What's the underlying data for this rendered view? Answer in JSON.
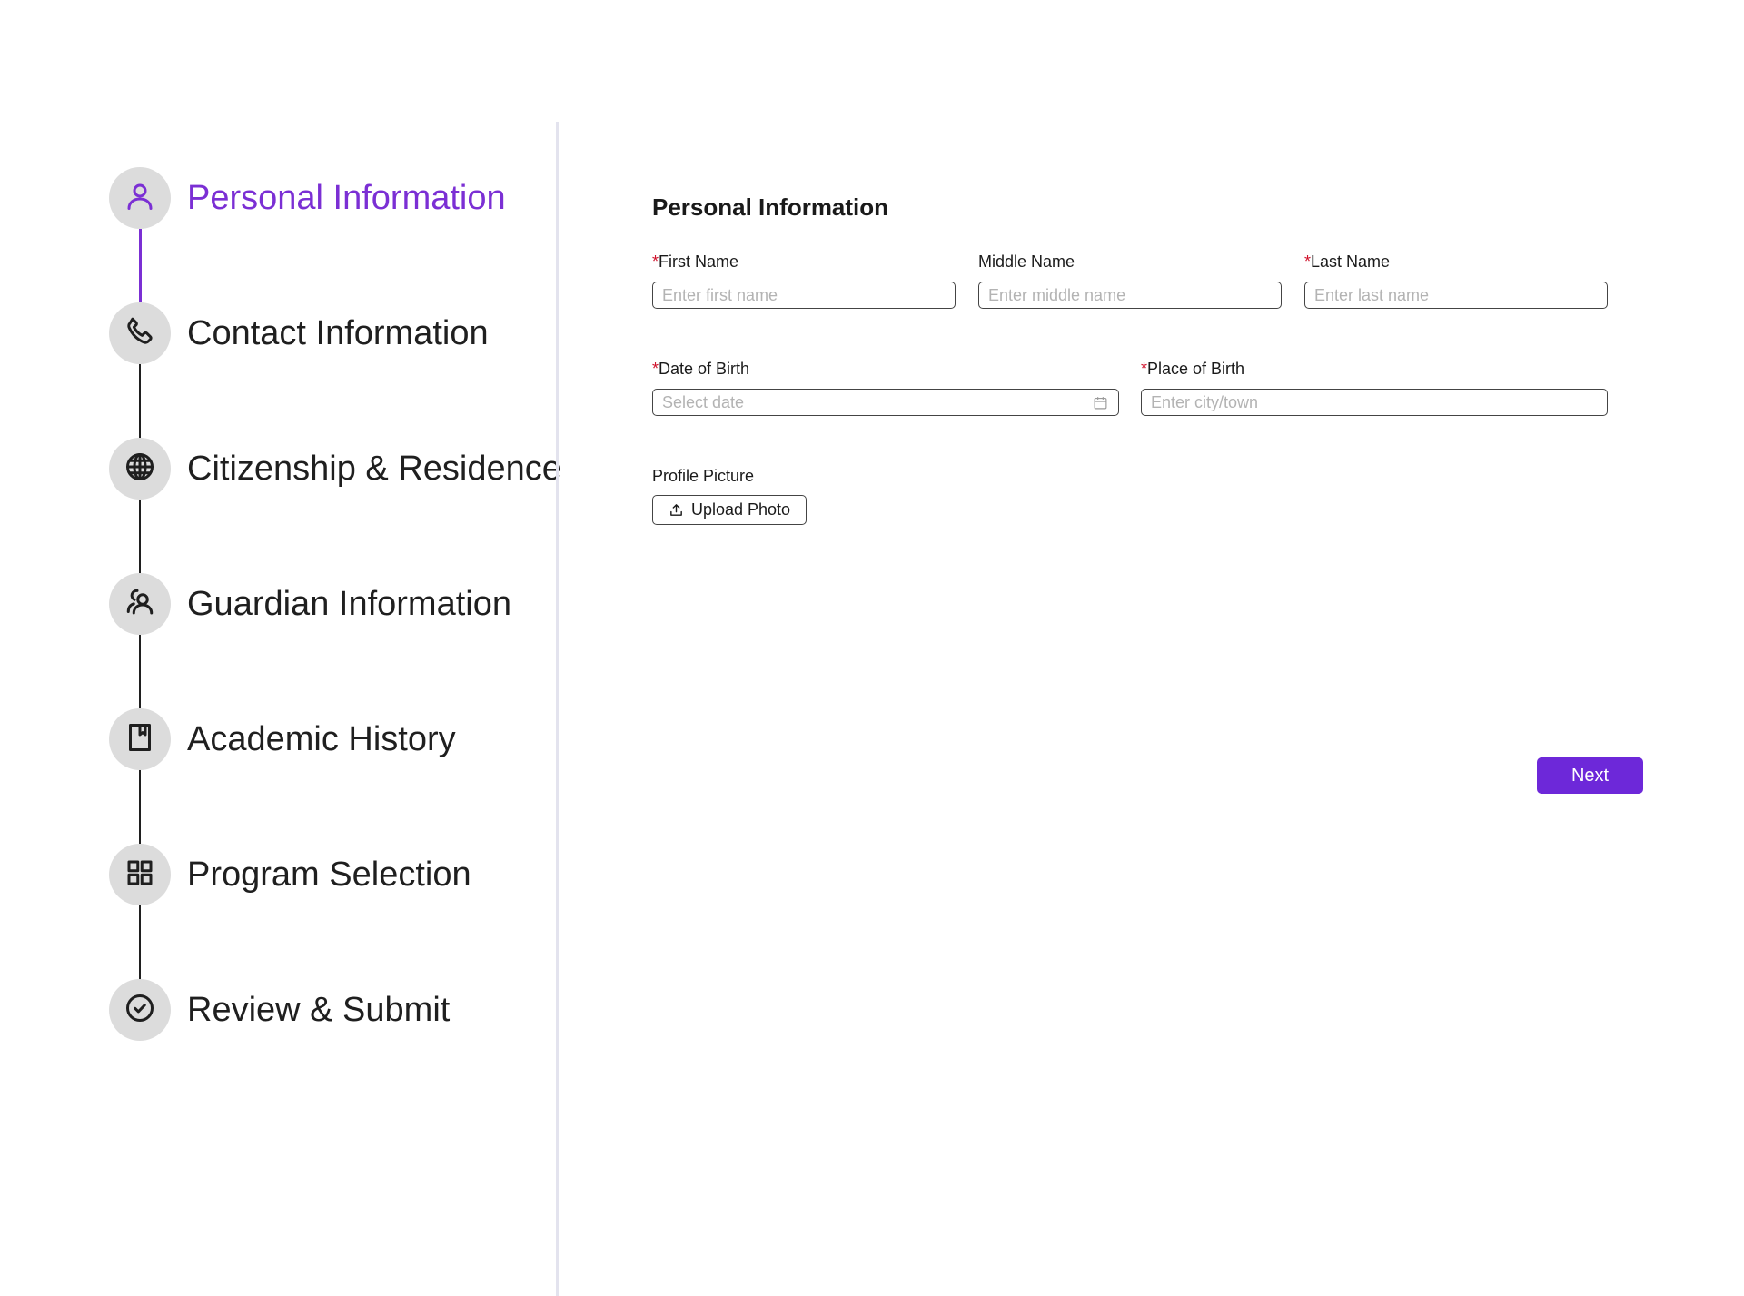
{
  "stepper": {
    "steps": [
      {
        "label": "Personal Information",
        "icon": "user-icon",
        "active": true
      },
      {
        "label": "Contact Information",
        "icon": "phone-icon",
        "active": false
      },
      {
        "label": "Citizenship & Residence",
        "icon": "globe-icon",
        "active": false
      },
      {
        "label": "Guardian Information",
        "icon": "users-icon",
        "active": false
      },
      {
        "label": "Academic History",
        "icon": "bookmark-book-icon",
        "active": false
      },
      {
        "label": "Program Selection",
        "icon": "grid-icon",
        "active": false
      },
      {
        "label": "Review & Submit",
        "icon": "check-circle-icon",
        "active": false
      }
    ],
    "active_color": "#7b2fd4",
    "circle_color": "#dcdcdc"
  },
  "form": {
    "title": "Personal Information",
    "required_marker": "*",
    "fields": {
      "first_name": {
        "label": "First Name",
        "placeholder": "Enter first name",
        "required": true
      },
      "middle_name": {
        "label": "Middle Name",
        "placeholder": "Enter middle name",
        "required": false
      },
      "last_name": {
        "label": "Last Name",
        "placeholder": "Enter last name",
        "required": true
      },
      "date_of_birth": {
        "label": "Date of Birth",
        "placeholder": "Select date",
        "required": true,
        "icon": "calendar-icon"
      },
      "place_of_birth": {
        "label": "Place of Birth",
        "placeholder": "Enter city/town",
        "required": true
      },
      "profile_picture": {
        "label": "Profile Picture",
        "button_label": "Upload Photo",
        "icon": "upload-icon"
      }
    },
    "next_button": {
      "label": "Next",
      "color": "#6d28d9"
    }
  }
}
